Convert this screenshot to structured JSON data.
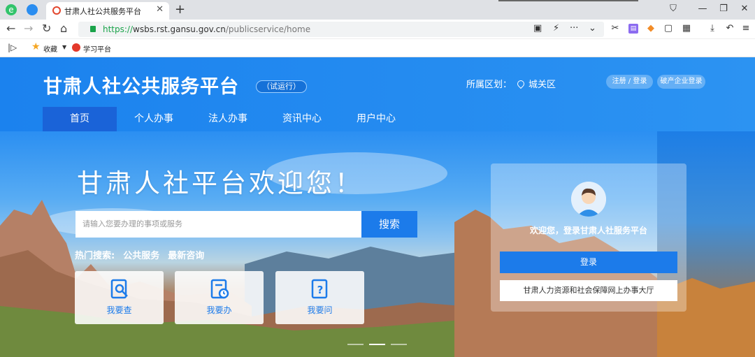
{
  "browser": {
    "tab_title": "甘肃人社公共服务平台",
    "url_scheme": "https://",
    "url_host": "wsbs.rst.gansu.gov.cn",
    "url_path": "/publicservice/home",
    "bookmarks": [
      "收藏",
      "学习平台"
    ]
  },
  "header": {
    "title": "甘肃人社公共服务平台",
    "badge": "（试运行）",
    "region_label": "所属区划：",
    "region_value": "城关区",
    "register_login": "注册 / 登录",
    "bankruptcy_login": "破产企业登录"
  },
  "nav": [
    "首页",
    "个人办事",
    "法人办事",
    "资讯中心",
    "用户中心"
  ],
  "hero": {
    "title": "甘肃人社平台欢迎您！",
    "search_placeholder": "请输入您要办理的事项或服务",
    "search_button": "搜索",
    "hot_label": "热门搜索:",
    "hot_items": [
      "公共服务",
      "最新咨询"
    ],
    "cards": [
      "我要查",
      "我要办",
      "我要问"
    ]
  },
  "login_panel": {
    "welcome": "欢迎您，登录甘肃人社服务平台",
    "login_button": "登录",
    "hall_link": "甘肃人力资源和社会保障网上办事大厅"
  },
  "colors": {
    "primary": "#1c7bea",
    "header_bg": "#1b82ee",
    "nav_active": "#1a63d8"
  }
}
